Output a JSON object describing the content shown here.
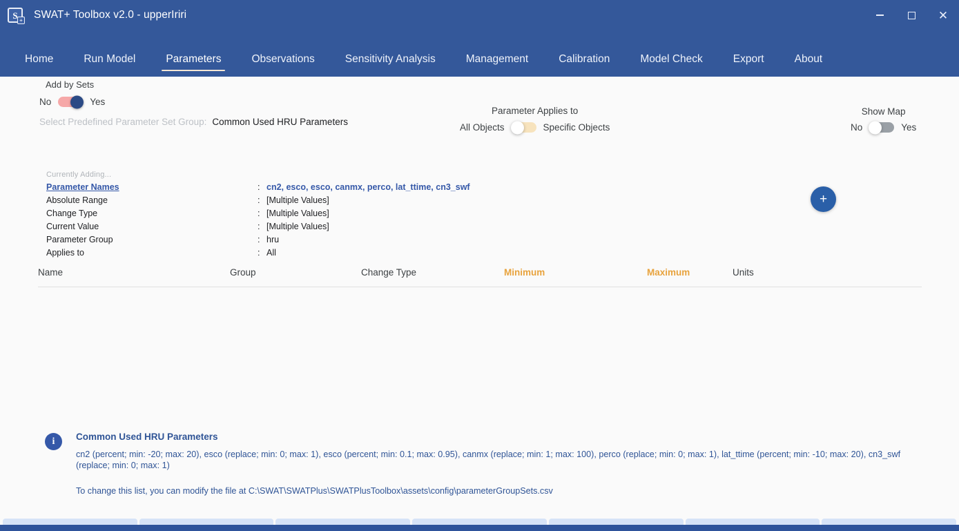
{
  "window": {
    "title": "SWAT+ Toolbox v2.0 - upperIriri",
    "app_icon": "swat-plus-icon",
    "controls": {
      "minimize": "minimize-icon",
      "maximize": "maximize-icon",
      "close": "close-icon"
    }
  },
  "nav": {
    "tabs": [
      {
        "label": "Home",
        "active": false
      },
      {
        "label": "Run Model",
        "active": false
      },
      {
        "label": "Parameters",
        "active": true
      },
      {
        "label": "Observations",
        "active": false
      },
      {
        "label": "Sensitivity Analysis",
        "active": false
      },
      {
        "label": "Management",
        "active": false
      },
      {
        "label": "Calibration",
        "active": false
      },
      {
        "label": "Model Check",
        "active": false
      },
      {
        "label": "Export",
        "active": false
      },
      {
        "label": "About",
        "active": false
      }
    ]
  },
  "add_by_sets": {
    "title": "Add by Sets",
    "off_label": "No",
    "on_label": "Yes",
    "state": "Yes"
  },
  "predefined_set": {
    "label": "Select Predefined Parameter Set Group:",
    "value": "Common Used HRU Parameters"
  },
  "applies_to": {
    "title": "Parameter Applies to",
    "off_label": "All Objects",
    "on_label": "Specific Objects",
    "state": "All Objects"
  },
  "add_button": {
    "label": "+",
    "name": "add-parameter-button"
  },
  "show_map": {
    "title": "Show Map",
    "off_label": "No",
    "on_label": "Yes",
    "state": "No"
  },
  "currently_adding": {
    "heading": "Currently Adding...",
    "rows": [
      {
        "key": "Parameter Names",
        "value": "cn2, esco, esco, canmx, perco, lat_ttime, cn3_swf"
      },
      {
        "key": "Absolute Range",
        "value": "[Multiple Values]"
      },
      {
        "key": "Change Type",
        "value": "[Multiple Values]"
      },
      {
        "key": "Current Value",
        "value": "[Multiple Values]"
      },
      {
        "key": "Parameter Group",
        "value": "hru"
      },
      {
        "key": "Applies to",
        "value": "All"
      }
    ]
  },
  "table": {
    "columns": [
      {
        "label": "Name",
        "accent": false
      },
      {
        "label": "Group",
        "accent": false
      },
      {
        "label": "Change Type",
        "accent": false
      },
      {
        "label": "Minimum",
        "accent": true
      },
      {
        "label": "Maximum",
        "accent": true
      },
      {
        "label": "Units",
        "accent": false
      }
    ],
    "rows": []
  },
  "info": {
    "icon": "info-icon",
    "title": "Common Used HRU Parameters",
    "text": "cn2 (percent; min: -20; max: 20), esco (replace; min: 0; max: 1), esco (percent; min: 0.1; max: 0.95), canmx (replace; min: 1; max: 100), perco (replace; min: 0; max: 1), lat_ttime (percent; min: -10; max: 20), cn3_swf (replace; min: 0; max: 1)",
    "note": "To change this list, you can modify the file at C:\\SWAT\\SWATPlus\\SWATPlusToolbox\\assets\\config\\parameterGroupSets.csv"
  },
  "colors": {
    "header_blue": "#34589a",
    "accent_orange": "#e8a33d",
    "link_blue": "#3558a8",
    "info_blue": "#2f5496",
    "toggle_pink": "#f6a8a8",
    "toggle_tan": "#f7e3bd",
    "toggle_gray": "#9aa0a6",
    "knob_navy": "#2b4a85",
    "plus_blue": "#2a5fa8",
    "background": "#fafafa"
  }
}
